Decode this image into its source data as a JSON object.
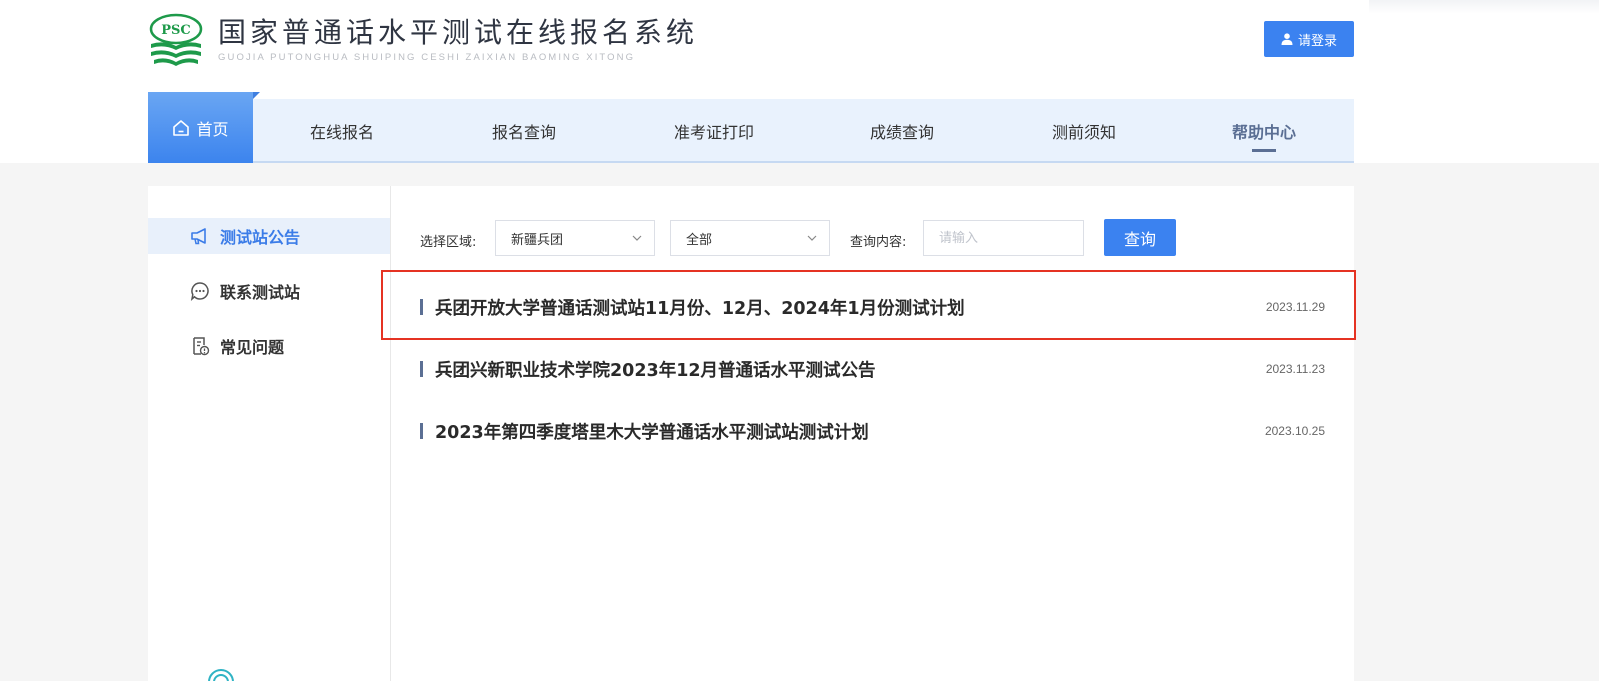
{
  "header": {
    "logo_text": "PSC",
    "title_cn": "国家普通话水平测试在线报名系统",
    "title_pinyin": "GUOJIA PUTONGHUA SHUIPING CESHI ZAIXIAN BAOMING XITONG",
    "login_label": "请登录",
    "brand_color": "#3b82f0"
  },
  "nav": {
    "items": [
      {
        "label": "首页",
        "icon": "home-icon"
      },
      {
        "label": "在线报名"
      },
      {
        "label": "报名查询"
      },
      {
        "label": "准考证打印"
      },
      {
        "label": "成绩查询"
      },
      {
        "label": "测前须知"
      },
      {
        "label": "帮助中心"
      }
    ],
    "active_index": 6
  },
  "sidebar": {
    "items": [
      {
        "label": "测试站公告",
        "icon": "megaphone-icon",
        "active": true
      },
      {
        "label": "联系测试站",
        "icon": "chat-bubble-icon",
        "active": false
      },
      {
        "label": "常见问题",
        "icon": "faq-document-icon",
        "active": false
      }
    ]
  },
  "filters": {
    "region_label": "选择区域:",
    "region_value": "新疆兵团",
    "scope_value": "全部",
    "query_label": "查询内容:",
    "query_placeholder": "请输入",
    "query_value": "",
    "search_button": "查询"
  },
  "announcements": [
    {
      "title": "兵团开放大学普通话测试站11月份、12月、2024年1月份测试计划",
      "date": "2023.11.29",
      "highlighted": true
    },
    {
      "title": "兵团兴新职业技术学院2023年12月普通话水平测试公告",
      "date": "2023.11.23",
      "highlighted": false
    },
    {
      "title": "2023年第四季度塔里木大学普通话水平测试站测试计划",
      "date": "2023.10.25",
      "highlighted": false
    }
  ],
  "colors": {
    "accent": "#3b82f0",
    "nav_bg": "#e9f2fd",
    "nav_active_text": "#5b6f94",
    "highlight_border": "#e53323"
  }
}
